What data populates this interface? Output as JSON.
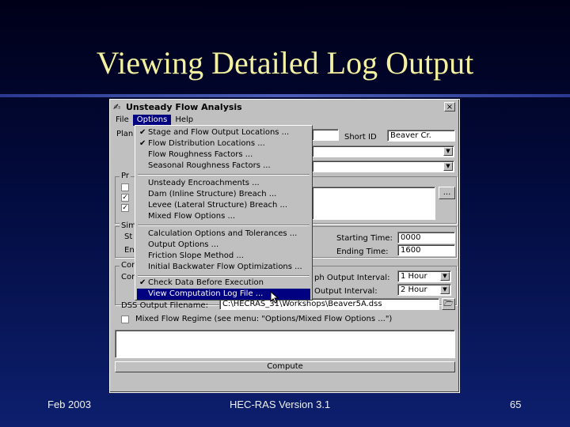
{
  "slide": {
    "title": "Viewing Detailed Log Output",
    "footer_left": "Feb 2003",
    "footer_center": "HEC-RAS Version 3.1",
    "footer_right": "65"
  },
  "window": {
    "title": "Unsteady Flow Analysis",
    "close_label": "×",
    "menus": [
      "File",
      "Options",
      "Help"
    ],
    "plan_label": "Plan",
    "short_id_label": "Short ID",
    "short_id_value": "Beaver Cr.",
    "starting_time_label": "Starting Time:",
    "starting_time_value": "0000",
    "ending_time_label": "Ending Time:",
    "ending_time_value": "1600",
    "hydrograph_interval_label": "ph Output Interval:",
    "hydrograph_interval_value": "1 Hour",
    "detailed_interval_label": "Output Interval:",
    "detailed_interval_value": "2 Hour",
    "dss_label": "DSS Output Filename:",
    "dss_value": "C:\\HECRAS_31\\Workshops\\Beaver5A.dss",
    "mixed_flow_label": "Mixed Flow Regime (see menu: \"Options/Mixed Flow Options ...\")",
    "browse_label": "...",
    "compute_label": "Compute",
    "partial_labels": {
      "pr": "Pr",
      "sim": "Sim",
      "st": "St",
      "en": "En",
      "com1": "Com",
      "com2": "Com"
    }
  },
  "options_menu": {
    "items": [
      {
        "label": "Stage and Flow Output Locations ...",
        "checked": true
      },
      {
        "label": "Flow Distribution Locations ...",
        "checked": true
      },
      {
        "label": "Flow Roughness Factors ...",
        "checked": false
      },
      {
        "label": "Seasonal Roughness Factors ...",
        "checked": false
      },
      {
        "label": "Unsteady Encroachments ...",
        "checked": false
      },
      {
        "label": "Dam (Inline Structure) Breach ...",
        "checked": false
      },
      {
        "label": "Levee (Lateral Structure) Breach ...",
        "checked": false
      },
      {
        "label": "Mixed Flow Options ...",
        "checked": false
      },
      {
        "label": "Calculation Options and Tolerances ...",
        "checked": false
      },
      {
        "label": "Output Options ...",
        "checked": false
      },
      {
        "label": "Friction Slope Method ...",
        "checked": false
      },
      {
        "label": "Initial Backwater Flow Optimizations ...",
        "checked": false
      },
      {
        "label": "Check Data Before Execution",
        "checked": true
      },
      {
        "label": "View Computation Log File ...",
        "checked": false,
        "highlighted": true
      }
    ],
    "check_mark": "✔"
  }
}
